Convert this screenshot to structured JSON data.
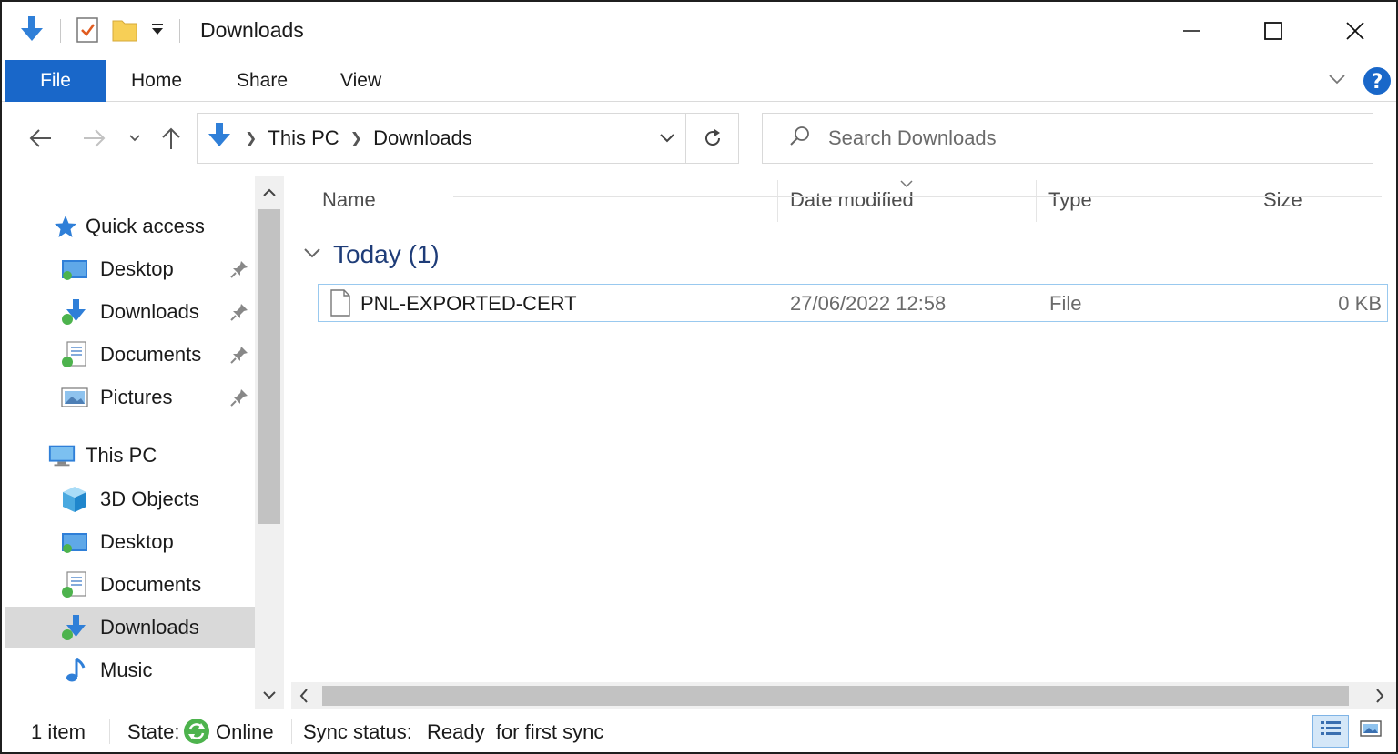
{
  "window": {
    "title": "Downloads"
  },
  "ribbon": {
    "tabs": [
      "File",
      "Home",
      "Share",
      "View"
    ]
  },
  "address": {
    "crumbs": [
      "This PC",
      "Downloads"
    ]
  },
  "search": {
    "placeholder": "Search Downloads"
  },
  "navpane": {
    "quick_access": "Quick access",
    "quick_items": [
      "Desktop",
      "Downloads",
      "Documents",
      "Pictures"
    ],
    "this_pc": "This PC",
    "pc_items": [
      "3D Objects",
      "Desktop",
      "Documents",
      "Downloads",
      "Music"
    ]
  },
  "columns": [
    "Name",
    "Date modified",
    "Type",
    "Size"
  ],
  "group": {
    "title": "Today (1)"
  },
  "files": [
    {
      "name": "PNL-EXPORTED-CERT",
      "date": "27/06/2022 12:58",
      "type": "File",
      "size": "0 KB"
    }
  ],
  "status": {
    "count": "1 item",
    "state_label": "State:",
    "state_value": "Online",
    "sync_label": "Sync status:",
    "sync_value": "Ready  for first sync"
  },
  "colors": {
    "accent": "#1967c9",
    "group_title": "#1e3c78",
    "selection_border": "#99c9ef"
  }
}
